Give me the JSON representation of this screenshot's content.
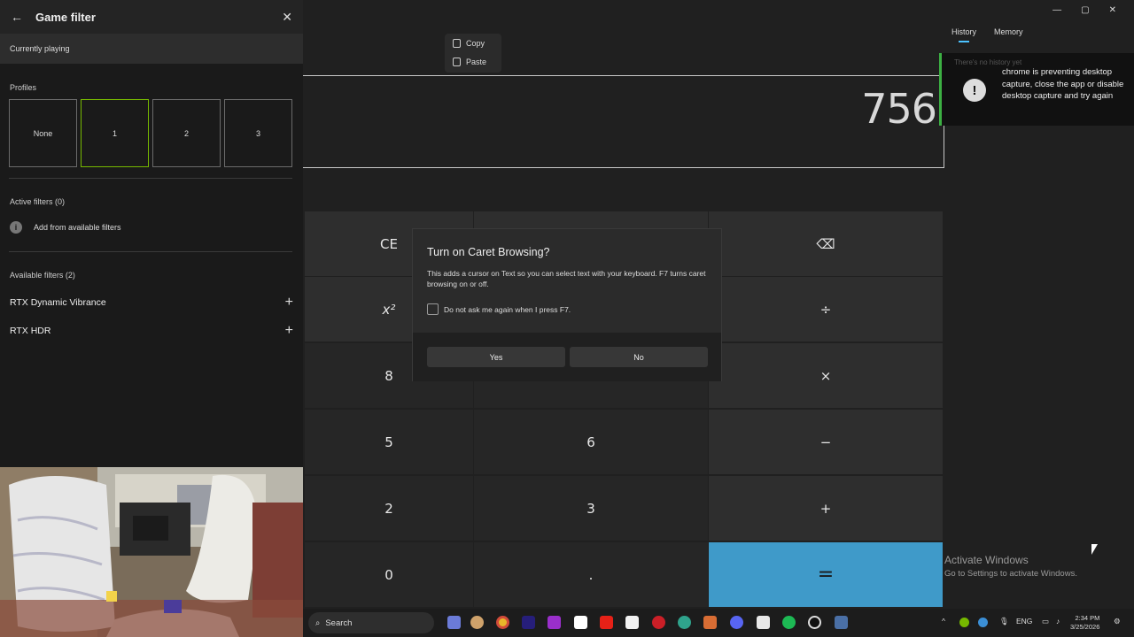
{
  "calculator": {
    "display_value": "756",
    "context_menu": [
      "Copy",
      "Paste"
    ],
    "keys": {
      "ce": "CE",
      "x_squared": "x²",
      "eight": "8",
      "five": "5",
      "six": "6",
      "two": "2",
      "three": "3",
      "zero": "0",
      "decimal": ".",
      "equals": "=",
      "backspace": "⌫",
      "divide": "÷",
      "multiply": "×",
      "minus": "−",
      "plus": "+"
    },
    "tabs": [
      "History",
      "Memory"
    ],
    "window_controls": [
      "—",
      "▢",
      "✕"
    ]
  },
  "toast": {
    "ghost_text": "There's no history yet",
    "message": "chrome is preventing desktop capture, close the app or disable desktop capture and try again",
    "icon": "!"
  },
  "activate_windows": {
    "title": "Activate Windows",
    "subtitle": "Go to Settings to activate Windows."
  },
  "game_filter": {
    "title": "Game filter",
    "currently_playing": "Currently playing",
    "profiles_label": "Profiles",
    "profiles": [
      "None",
      "1",
      "2",
      "3"
    ],
    "active_profile": "1",
    "active_filters_label": "Active filters (0)",
    "add_filters": "Add from available filters",
    "available_filters_label": "Available filters (2)",
    "available_filters": [
      "RTX Dynamic Vibrance",
      "RTX HDR"
    ]
  },
  "dialog": {
    "title": "Turn on Caret Browsing?",
    "body": "This adds a cursor on Text so you can select text with your keyboard. F7 turns caret browsing on or off.",
    "checkbox_label": "Do not ask me again when I press F7.",
    "yes": "Yes",
    "no": "No"
  },
  "taskbar": {
    "search_placeholder": "Search",
    "lang": "ENG",
    "time": "2:34 PM",
    "date": "3/25/2026",
    "accent": "#3f9ac9"
  }
}
